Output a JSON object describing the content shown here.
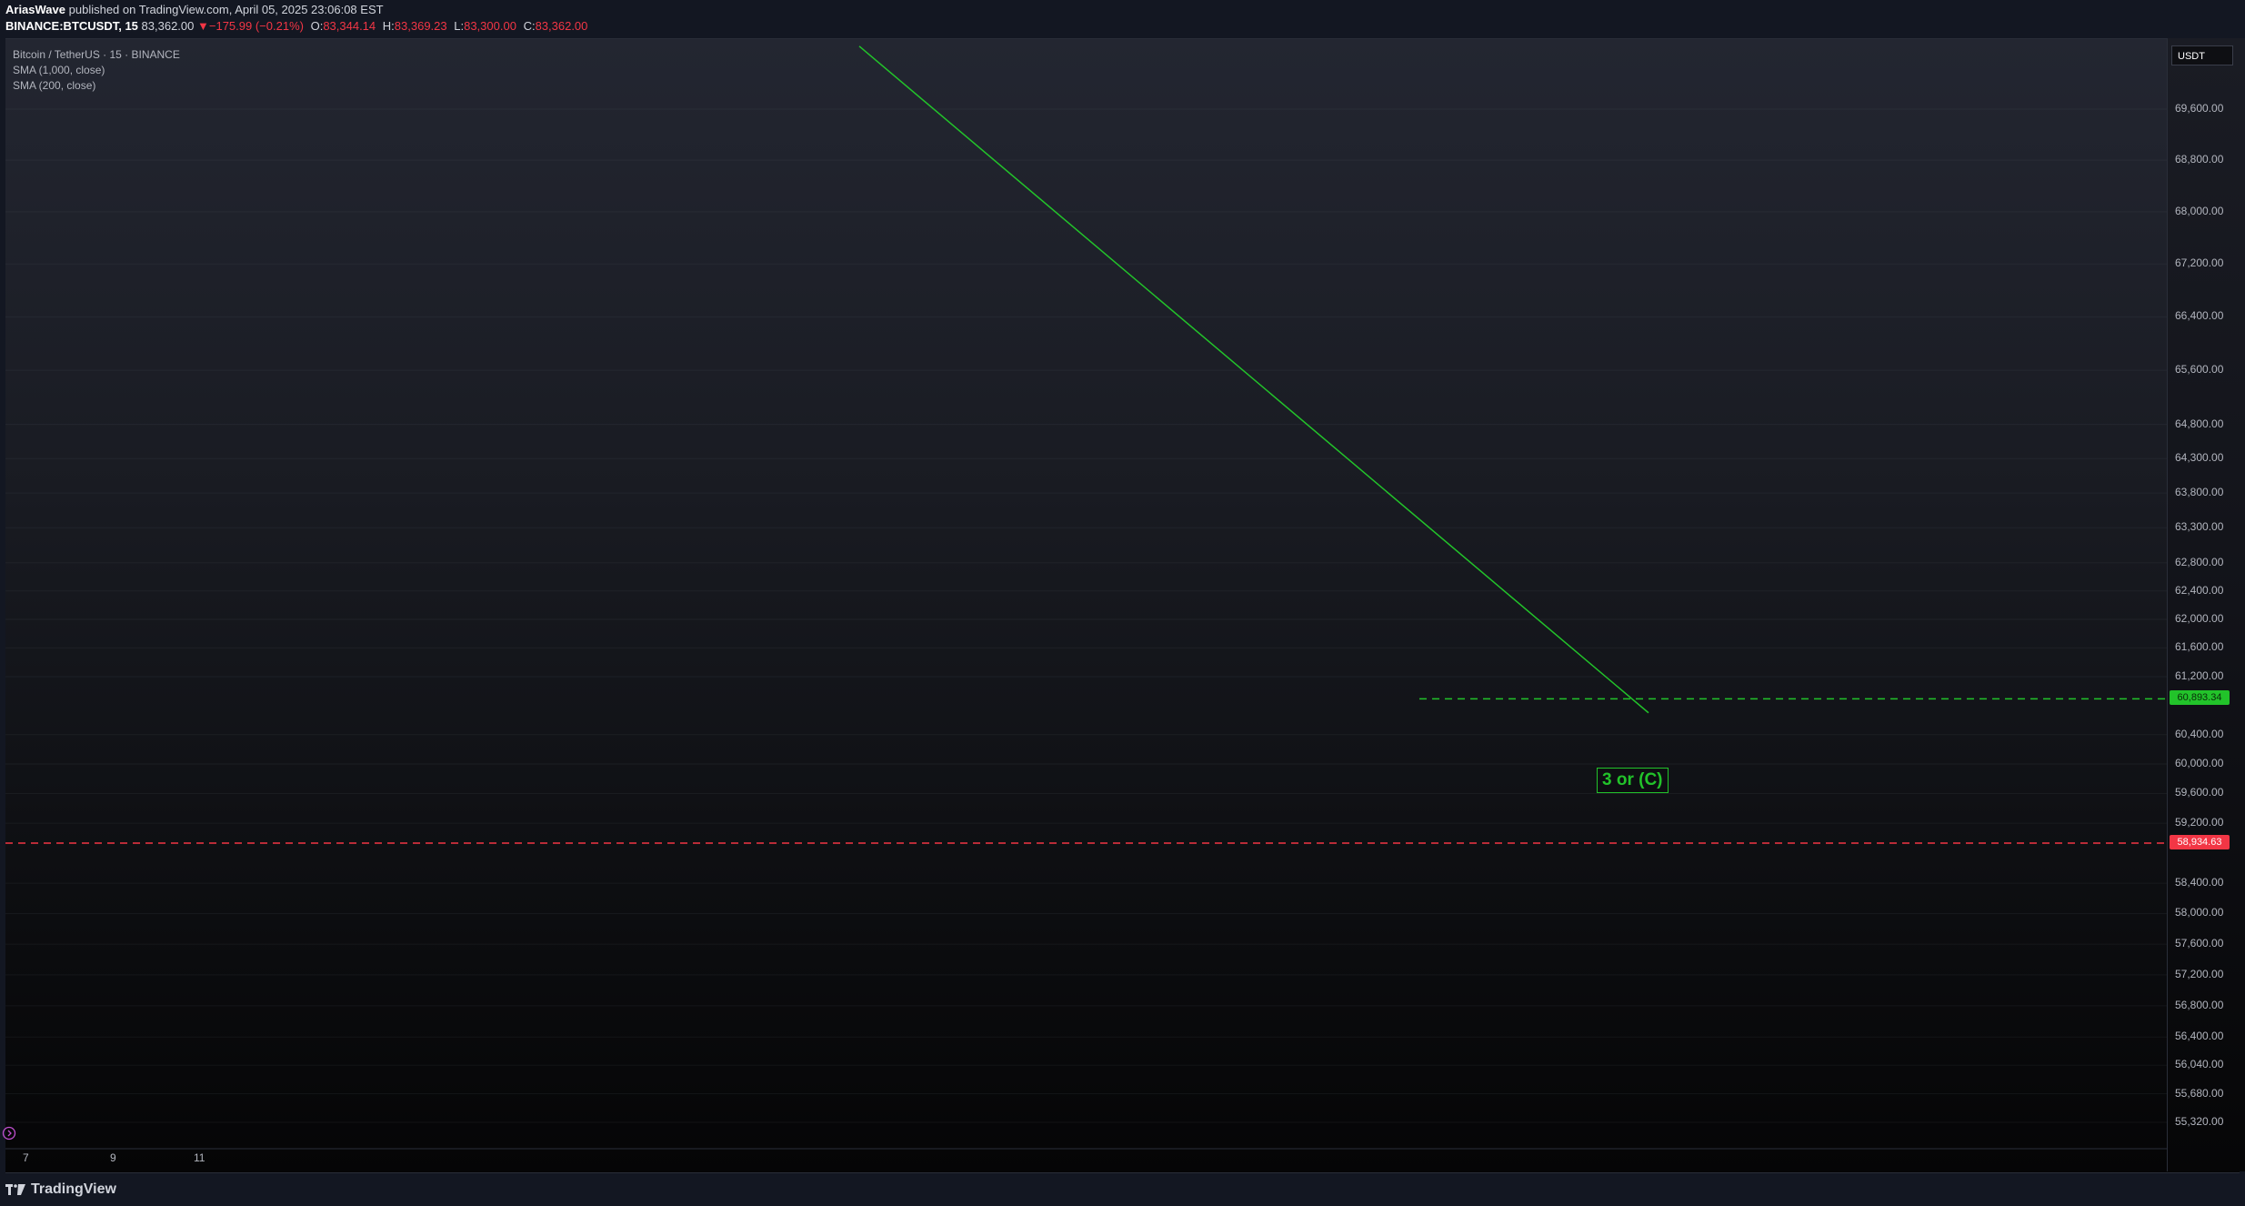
{
  "header": {
    "author": "AriasWave",
    "published_text": "published on TradingView.com, April 05, 2025 23:06:08 EST",
    "symbol": "BINANCE:BTCUSDT, 15",
    "last_price": "83,362.00",
    "change": "−175.99 (−0.21%)",
    "open_label": "O:",
    "open": "83,344.14",
    "high_label": "H:",
    "high": "83,369.23",
    "low_label": "L:",
    "low": "83,300.00",
    "close_label": "C:",
    "close": "83,362.00"
  },
  "legend": {
    "instrument": "Bitcoin / TetherUS · 15 · BINANCE",
    "sma1": "SMA (1,000, close)",
    "sma2": "SMA (200, close)"
  },
  "currency": "USDT",
  "footer": {
    "brand": "TradingView"
  },
  "colors": {
    "green": "#22c32a",
    "red": "#f23645",
    "background": "#131722"
  },
  "chart_data": {
    "type": "line",
    "y_scale": "log",
    "ylim": [
      55000,
      70500
    ],
    "y_ticks": [
      {
        "value": 69600,
        "label": "69,600.00"
      },
      {
        "value": 68800,
        "label": "68,800.00"
      },
      {
        "value": 68000,
        "label": "68,000.00"
      },
      {
        "value": 67200,
        "label": "67,200.00"
      },
      {
        "value": 66400,
        "label": "66,400.00"
      },
      {
        "value": 65600,
        "label": "65,600.00"
      },
      {
        "value": 64800,
        "label": "64,800.00"
      },
      {
        "value": 64300,
        "label": "64,300.00"
      },
      {
        "value": 63800,
        "label": "63,800.00"
      },
      {
        "value": 63300,
        "label": "63,300.00"
      },
      {
        "value": 62800,
        "label": "62,800.00"
      },
      {
        "value": 62400,
        "label": "62,400.00"
      },
      {
        "value": 62000,
        "label": "62,000.00"
      },
      {
        "value": 61600,
        "label": "61,600.00"
      },
      {
        "value": 61200,
        "label": "61,200.00"
      },
      {
        "value": 60400,
        "label": "60,400.00"
      },
      {
        "value": 60000,
        "label": "60,000.00"
      },
      {
        "value": 59600,
        "label": "59,600.00"
      },
      {
        "value": 59200,
        "label": "59,200.00"
      },
      {
        "value": 58400,
        "label": "58,400.00"
      },
      {
        "value": 58000,
        "label": "58,000.00"
      },
      {
        "value": 57600,
        "label": "57,600.00"
      },
      {
        "value": 57200,
        "label": "57,200.00"
      },
      {
        "value": 56800,
        "label": "56,800.00"
      },
      {
        "value": 56400,
        "label": "56,400.00"
      },
      {
        "value": 56040,
        "label": "56,040.00"
      },
      {
        "value": 55680,
        "label": "55,680.00"
      },
      {
        "value": 55320,
        "label": "55,320.00"
      }
    ],
    "x_ticks": [
      "7",
      "9",
      "11"
    ],
    "trendline": {
      "color": "#22c32a",
      "from": {
        "price": 70600
      },
      "to": {
        "price": 60700
      }
    },
    "levels": [
      {
        "price": 60893.34,
        "label": "60,893.34",
        "color": "#22c32a",
        "style": "dashed"
      },
      {
        "price": 58934.63,
        "label": "58,934.63",
        "color": "#f23645",
        "style": "dashed"
      }
    ],
    "annotations": [
      {
        "text": "3 or (C)",
        "color": "#22c32a"
      }
    ]
  }
}
